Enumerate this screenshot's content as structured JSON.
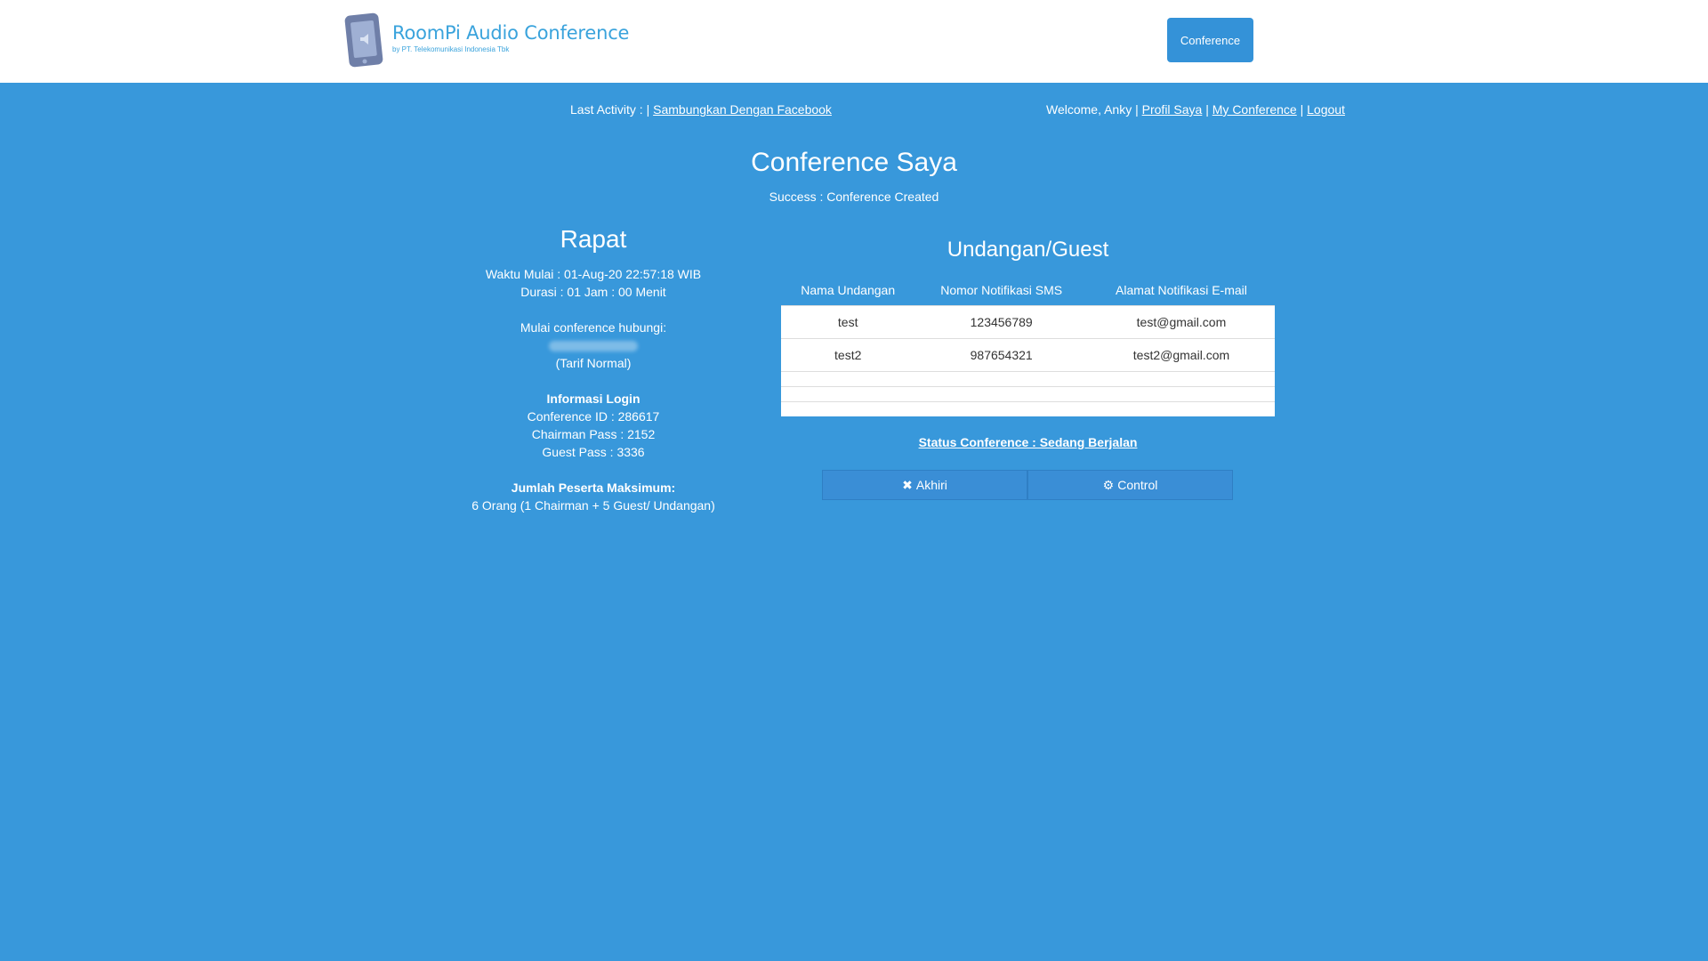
{
  "header": {
    "app_title": "RoomPi Audio Conference",
    "app_subtitle": "by PT. Telekomunikasi Indonesia Tbk",
    "conference_button": "Conference"
  },
  "topbar": {
    "last_activity": "Last Activity : |",
    "facebook_link": "Sambungkan Dengan Facebook",
    "welcome": "Welcome, Anky |",
    "profile_link": "Profil Saya",
    "sep1": "|",
    "my_conference_link": "My Conference",
    "sep2": "|",
    "logout_link": "Logout"
  },
  "page": {
    "title": "Conference Saya",
    "message": "Success : Conference Created"
  },
  "rapat": {
    "title": "Rapat",
    "start_time": "Waktu Mulai : 01-Aug-20 22:57:18 WIB",
    "duration": "Durasi : 01 Jam : 00 Menit",
    "contact_label": "Mulai conference hubungi:",
    "tariff": "(Tarif Normal)",
    "login_heading": "Informasi Login",
    "conference_id": "Conference ID : 286617",
    "chairman_pass": "Chairman Pass : 2152",
    "guest_pass": "Guest Pass : 3336",
    "max_heading": "Jumlah Peserta Maksimum:",
    "max_value": "6 Orang (1 Chairman + 5 Guest/ Undangan)"
  },
  "guests": {
    "title": "Undangan/Guest",
    "columns": [
      "Nama Undangan",
      "Nomor Notifikasi SMS",
      "Alamat Notifikasi E-mail"
    ],
    "rows": [
      [
        "test",
        "123456789",
        "test@gmail.com"
      ],
      [
        "test2",
        "987654321",
        "test2@gmail.com"
      ]
    ]
  },
  "status": {
    "link": "Status Conference : Sedang Berjalan"
  },
  "actions": {
    "end_label": "Akhiri",
    "control_label": "Control"
  },
  "colors": {
    "background": "#3898DB",
    "accent": "#3492D8"
  }
}
